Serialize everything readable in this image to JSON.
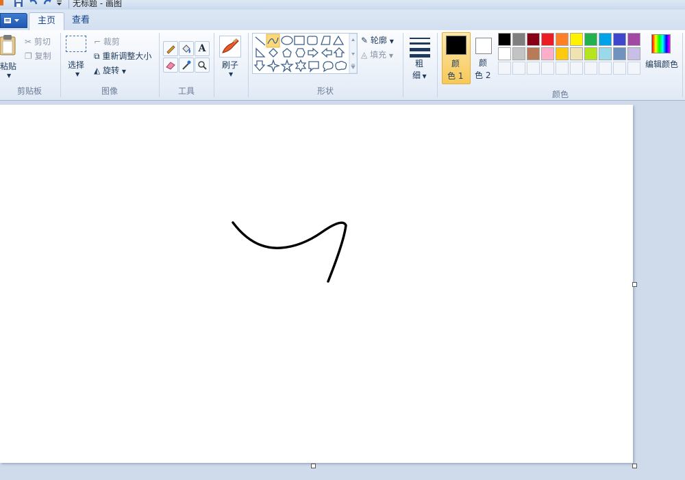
{
  "window": {
    "title": "无标题 - 画图"
  },
  "quick_access": {
    "items": [
      "save-icon",
      "undo-icon",
      "redo-icon",
      "customize-icon"
    ]
  },
  "tabs": [
    {
      "label": "主页",
      "active": true
    },
    {
      "label": "查看",
      "active": false
    }
  ],
  "clipboard": {
    "paste_label": "粘贴",
    "cut_label": "剪切",
    "copy_label": "复制",
    "group_label": "剪贴板"
  },
  "image": {
    "select_label": "选择",
    "crop_label": "裁剪",
    "resize_label": "重新调整大小",
    "rotate_label": "旋转",
    "group_label": "图像"
  },
  "tools": {
    "group_label": "工具",
    "items": [
      "pencil-icon",
      "fill-icon",
      "text-icon",
      "eraser-icon",
      "color-picker-icon",
      "magnifier-icon"
    ]
  },
  "brushes": {
    "label": "刷子"
  },
  "shapes": {
    "outline_label": "轮廓",
    "fill_label": "填充",
    "group_label": "形状",
    "selected": "curve"
  },
  "size": {
    "label1": "粗",
    "label2": "细"
  },
  "colors": {
    "color1_label1": "颜",
    "color1_label2": "色 1",
    "color2_label1": "颜",
    "color2_label2": "色 2",
    "color1": "#000000",
    "color2": "#ffffff",
    "edit_label": "编辑颜色",
    "group_label": "颜色",
    "palette_row1": [
      "#000000",
      "#7f7f7f",
      "#880015",
      "#ed1c24",
      "#ff7f27",
      "#fff200",
      "#22b14c",
      "#00a2e8",
      "#3f48cc",
      "#a349a4"
    ],
    "palette_row2": [
      "#ffffff",
      "#c3c3c3",
      "#b97a57",
      "#ffaec9",
      "#ffc90e",
      "#efe4b0",
      "#b5e61d",
      "#99d9ea",
      "#7092be",
      "#c8bfe7"
    ]
  },
  "canvas": {
    "stroke_color": "#000000"
  }
}
